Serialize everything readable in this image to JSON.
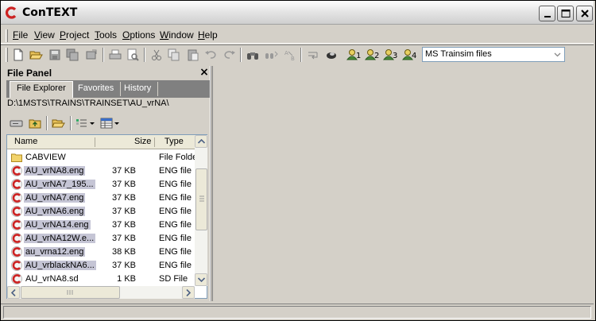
{
  "app": {
    "title": "ConTEXT",
    "accent": "#cc2222"
  },
  "menu": [
    {
      "label": "File",
      "ul": "F",
      "rest": "ile"
    },
    {
      "label": "View",
      "ul": "V",
      "rest": "iew"
    },
    {
      "label": "Project",
      "ul": "P",
      "rest": "roject"
    },
    {
      "label": "Tools",
      "ul": "T",
      "rest": "ools"
    },
    {
      "label": "Options",
      "ul": "O",
      "rest": "ptions"
    },
    {
      "label": "Window",
      "ul": "W",
      "rest": "indow"
    },
    {
      "label": "Help",
      "ul": "H",
      "rest": "elp"
    }
  ],
  "toolbar": {
    "user_tool_numbers": [
      "1",
      "2",
      "3",
      "4"
    ],
    "filetype": {
      "value": "MS Trainsim files"
    }
  },
  "file_panel": {
    "title": "File Panel",
    "close": "×",
    "tabs": [
      "File Explorer",
      "Favorites",
      "History"
    ],
    "active_tab": "File Explorer",
    "path": "D:\\1MSTS\\TRAINS\\TRAINSET\\AU_vrNA\\",
    "columns": {
      "name": "Name",
      "size": "Size",
      "type": "Type"
    },
    "files": [
      {
        "name": "CABVIEW",
        "size": "",
        "type": "File Folder",
        "icon": "folder-icon",
        "selected": false
      },
      {
        "name": "AU_vrNA8.eng",
        "size": "37 KB",
        "type": "ENG file",
        "icon": "context-file-icon",
        "selected": true
      },
      {
        "name": "AU_vrNA7_195...",
        "size": "37 KB",
        "type": "ENG file",
        "icon": "context-file-icon",
        "selected": true
      },
      {
        "name": "AU_vrNA7.eng",
        "size": "37 KB",
        "type": "ENG file",
        "icon": "context-file-icon",
        "selected": true
      },
      {
        "name": "AU_vrNA6.eng",
        "size": "37 KB",
        "type": "ENG file",
        "icon": "context-file-icon",
        "selected": true
      },
      {
        "name": "AU_vrNA14.eng",
        "size": "37 KB",
        "type": "ENG file",
        "icon": "context-file-icon",
        "selected": true
      },
      {
        "name": "AU_vrNA12W.e...",
        "size": "37 KB",
        "type": "ENG file",
        "icon": "context-file-icon",
        "selected": true
      },
      {
        "name": "au_vrna12.eng",
        "size": "38 KB",
        "type": "ENG file",
        "icon": "context-file-icon",
        "selected": true
      },
      {
        "name": "AU_vrblackNA6...",
        "size": "37 KB",
        "type": "ENG file",
        "icon": "context-file-icon",
        "selected": true
      },
      {
        "name": "AU_vrNA8.sd",
        "size": "1 KB",
        "type": "SD File",
        "icon": "context-file-icon",
        "selected": false
      }
    ]
  }
}
